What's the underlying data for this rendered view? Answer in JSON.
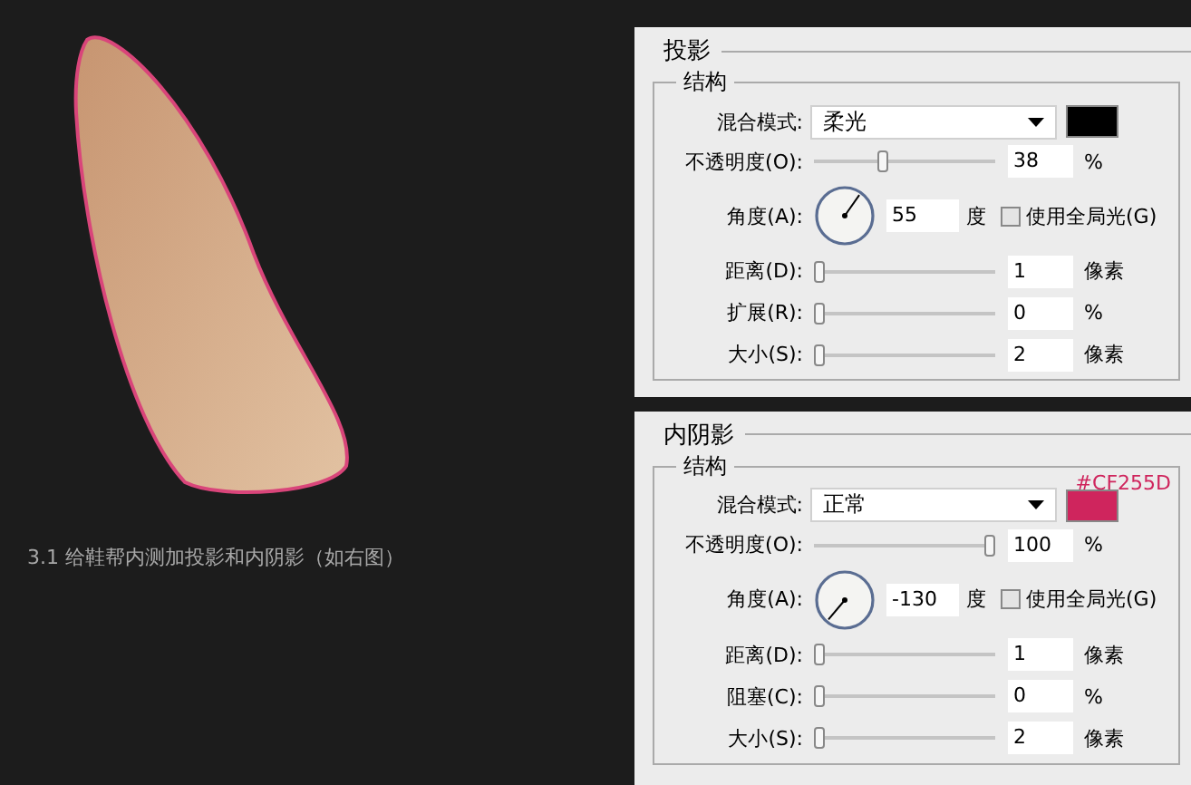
{
  "caption": "3.1 给鞋帮内测加投影和内阴影（如右图）",
  "panels": [
    {
      "title": "投影",
      "group": "结构",
      "blend": {
        "label": "混合模式:",
        "value": "柔光",
        "color": "#000000"
      },
      "opacity": {
        "label": "不透明度(O):",
        "level": 0.37,
        "value": "38",
        "unit": "%"
      },
      "angle": {
        "label": "角度(A):",
        "value": "55",
        "unit": "度",
        "global_light": {
          "label": "使用全局光(G)",
          "checked": false
        }
      },
      "sliders": [
        {
          "label": "距离(D):",
          "level": 0,
          "value": "1",
          "unit": "像素"
        },
        {
          "label": "扩展(R):",
          "level": 0,
          "value": "0",
          "unit": "%"
        },
        {
          "label": "大小(S):",
          "level": 0,
          "value": "2",
          "unit": "像素"
        }
      ]
    },
    {
      "title": "内阴影",
      "group": "结构",
      "note": "#CF255D",
      "blend": {
        "label": "混合模式:",
        "value": "正常",
        "color": "#cf255d"
      },
      "opacity": {
        "label": "不透明度(O):",
        "level": 1,
        "value": "100",
        "unit": "%"
      },
      "angle": {
        "label": "角度(A):",
        "value": "-130",
        "unit": "度",
        "global_light": {
          "label": "使用全局光(G)",
          "checked": false
        }
      },
      "sliders": [
        {
          "label": "距离(D):",
          "level": 0,
          "value": "1",
          "unit": "像素"
        },
        {
          "label": "阻塞(C):",
          "level": 0,
          "value": "0",
          "unit": "%"
        },
        {
          "label": "大小(S):",
          "level": 0,
          "value": "2",
          "unit": "像素"
        }
      ]
    }
  ]
}
